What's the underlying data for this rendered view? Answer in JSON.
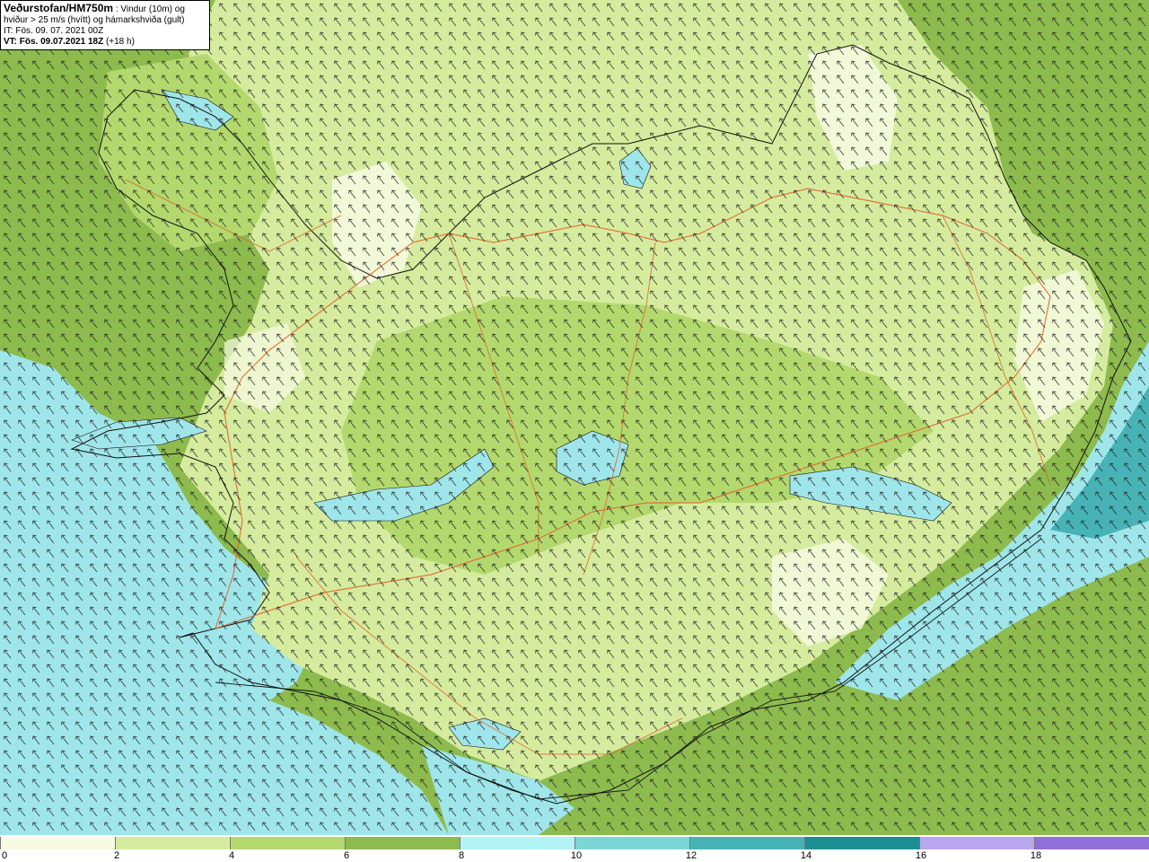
{
  "header": {
    "agency_model": "Veðurstofan/HM750m",
    "description_line1": " : Vindur (10m) og",
    "description_line2": "hviður > 25 m/s (hvítt) og hámarkshviða (gult)",
    "init_time": "IT: Fös. 09. 07. 2021 00Z",
    "valid_time": "VT: Fös. 09.07.2021 18Z",
    "lead_time": " (+18 h)"
  },
  "legend": {
    "ticks": [
      "0",
      "2",
      "4",
      "6",
      "8",
      "10",
      "12",
      "14",
      "16",
      "18"
    ],
    "colors": [
      "#f6fbe2",
      "#d5ec9f",
      "#b3d96e",
      "#8dbb4e",
      "#b2f4f6",
      "#7bd6d6",
      "#47b3b6",
      "#1c8f92",
      "#b8a6ee",
      "#9070d8"
    ]
  },
  "map": {
    "sea_color": "#8dbb4e",
    "calm_sea_color": "#9fe6ea",
    "coastline_color": "#111111",
    "road_color": "#e0642a"
  }
}
